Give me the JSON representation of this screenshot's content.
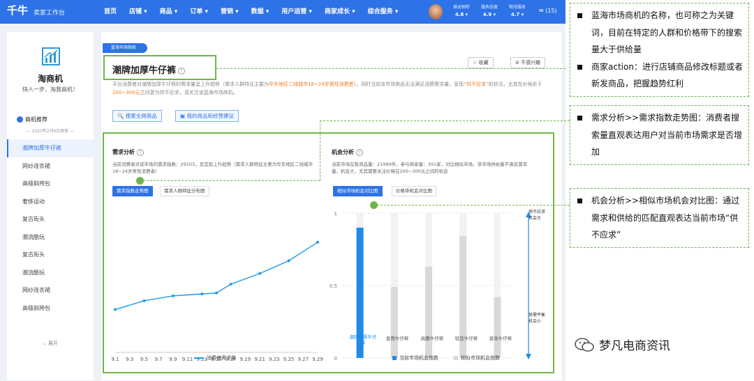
{
  "app": {
    "logo": "千牛",
    "logo_sub": "卖家工作台",
    "nav": [
      "首页",
      "店铺 ▾",
      "商品 ▾",
      "订单 ▾",
      "营销 ▾",
      "数据 ▾",
      "用户运营 ▾",
      "商家成长 ▾",
      "综合服务 ▾"
    ],
    "stats": [
      {
        "label": "描述相符",
        "value": "4.8 ▾"
      },
      {
        "label": "服务态度",
        "value": "4.9 ▾"
      },
      {
        "label": "物流服务",
        "value": "4.7 ▾"
      }
    ],
    "mail": "✉ (15)"
  },
  "sidebar": {
    "title": "淘商机",
    "slogan": "快人一步，淘我商机！",
    "section": "商机推荐",
    "date": "— 2020年2月6日更新 —",
    "items": [
      "潮牌加厚牛仔裤",
      "网纱连衣裙",
      "高级斜挎包",
      "奢侈运动",
      "复古街头",
      "潮流酷玩",
      "复古街头",
      "潮流酷玩",
      "网纱连衣裙",
      "高级斜挎包"
    ],
    "expand": "⌄ 展开"
  },
  "main": {
    "tag": "蓝海市场商机",
    "title": "潮牌加厚牛仔裤",
    "collect": "☆ 收藏",
    "dislike": "⊘ 不感兴趣",
    "desc_1": "平台消费者对潮牌加厚牛仔裤的需求量呈上升趋势（需求人群特征主要为",
    "desc_hl1": "华东地区二线城市18~24岁男性消费者",
    "desc_2": "），同时当前该市场商品无法满足消费需求量，呈现",
    "desc_hl2": "“供不应求”",
    "desc_3": "的状况，尤其在价格处于",
    "desc_hl3": "200~300元",
    "desc_4": "之间更为供不应求，请关注该蓝海市场商机。",
    "search_btn": "搜索全网商品",
    "advice_btn": "我的商品和经营建议"
  },
  "demand": {
    "title": "需求分析",
    "desc": "当前消费者对该市场的需求指数：29103，且呈现上升趋势（需求人群特征主要为华东地区二线城市18~24岁男性消费者）",
    "tab1": "需求指数走势图",
    "tab2": "需求人群特征分布图",
    "legend": "消费者需求量"
  },
  "opportunity": {
    "title": "机会分析",
    "desc": "当前市场在售商品量：21990件，参与商家量：391家，对比相似市场，该市场供给量不满足需求量，机会大，尤其需要关注价格在200~300元之间的机会",
    "tab1": "相似市场机会对比图",
    "tab2": "价格带机会对比图",
    "right_top": "供不应求\n机会大",
    "right_bottom": "供需平衡\n机会小",
    "legend1": "当前市场机会指数",
    "legend2": "相似市场机会指数"
  },
  "chart_data": [
    {
      "type": "line",
      "x": [
        "9.1",
        "9.3",
        "9.5",
        "9.7",
        "9.9",
        "9.11",
        "9.13",
        "9.15",
        "9.17",
        "9.19",
        "9.21",
        "9.23",
        "9.25",
        "9.27",
        "9.29"
      ],
      "series": [
        {
          "name": "消费者需求量",
          "x": [
            "9.1",
            "9.5",
            "9.9",
            "9.13",
            "9.15",
            "9.17",
            "9.21",
            "9.25",
            "9.29"
          ],
          "values": [
            0.44,
            0.53,
            0.58,
            0.6,
            0.61,
            0.7,
            0.81,
            0.94,
            1.13
          ]
        }
      ],
      "ylim": [
        0,
        1.5
      ],
      "colors": {
        "line": "#1e9be8"
      }
    },
    {
      "type": "bar",
      "categories": [
        "潮牌加厚牛仔裤",
        "直筒牛仔裤",
        "高腰牛仔裤",
        "轻型牛仔裤",
        "紧身牛仔裤"
      ],
      "yticks": [
        "0",
        "0.5",
        "1"
      ],
      "ylim": [
        0,
        1
      ],
      "series": [
        {
          "name": "当前市场机会指数",
          "values": [
            0.9,
            null,
            null,
            null,
            null
          ],
          "color": "#1f8ae8"
        },
        {
          "name": "相似市场机会指数",
          "values": [
            null,
            0.49,
            0.63,
            0.84,
            0.42
          ],
          "color": "#d9d9d9"
        }
      ]
    }
  ],
  "annotations": [
    [
      "蓝海市场商机的名称，也可称之为关键词，目前在特定的人群和价格带下的搜索量大于供给量",
      "商家action：进行店铺商品修改标题或者新发商品，把握趋势红利"
    ],
    [
      "需求分析>>需求指数走势图：消费者搜索量直观表达用户对当前市场需求是否增加"
    ],
    [
      "机会分析>>相似市场机会对比图：通过需求和供给的匹配直观表达当前市场“供不应求”"
    ]
  ],
  "watermark": "梦凡电商资讯",
  "colors": {
    "primary": "#2d72e6",
    "accent": "#ef7a21",
    "annotation": "#6fb64a"
  }
}
